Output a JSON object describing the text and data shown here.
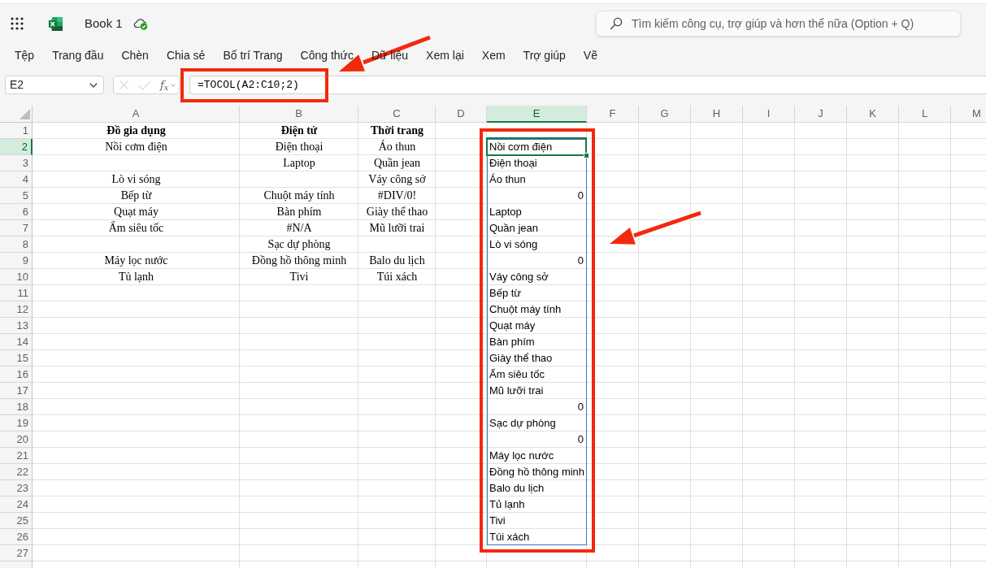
{
  "app": {
    "document_title": "Book 1"
  },
  "search": {
    "placeholder": "Tìm kiếm công cụ, trợ giúp và hơn thế nữa (Option + Q)"
  },
  "ribbon_tabs": [
    "Tệp",
    "Trang đầu",
    "Chèn",
    "Chia sẻ",
    "Bố trí Trang",
    "Công thức",
    "Dữ liệu",
    "Xem lại",
    "Xem",
    "Trợ giúp",
    "Vẽ"
  ],
  "formula_bar": {
    "name_box": "E2",
    "edit_buttons_disabled": true,
    "function_label": "f$_{x}$",
    "formula": "=TOCOL(A2:C10;2)"
  },
  "sheet": {
    "columns": [
      {
        "label": "A",
        "selected": false
      },
      {
        "label": "B",
        "selected": false
      },
      {
        "label": "C",
        "selected": false
      },
      {
        "label": "D",
        "selected": false
      },
      {
        "label": "E",
        "selected": true
      },
      {
        "label": "F",
        "selected": false
      },
      {
        "label": "G",
        "selected": false
      },
      {
        "label": "H",
        "selected": false
      },
      {
        "label": "I",
        "selected": false
      },
      {
        "label": "J",
        "selected": false
      },
      {
        "label": "K",
        "selected": false
      },
      {
        "label": "L",
        "selected": false
      },
      {
        "label": "M",
        "selected": false
      }
    ],
    "spill_outline": true,
    "rows": [
      {
        "label": "1",
        "selected": false,
        "cells": [
          {
            "kind": "text",
            "text": "Đồ gia dụng",
            "bold": true
          },
          {
            "kind": "text",
            "text": "Điện tử",
            "bold": true
          },
          {
            "kind": "text",
            "text": "Thời trang",
            "bold": true
          }
        ]
      },
      {
        "label": "2",
        "selected": true,
        "cells": [
          {
            "kind": "text",
            "text": "Nồi cơm điện",
            "bold": false
          },
          {
            "kind": "text",
            "text": "Điện thoại",
            "bold": false
          },
          {
            "kind": "text",
            "text": "Áo thun",
            "bold": false
          }
        ],
        "result": {
          "kind": "text",
          "text": "Nồi cơm điện"
        }
      },
      {
        "label": "3",
        "selected": false,
        "cells": [
          {
            "kind": "blank"
          },
          {
            "kind": "text",
            "text": "Laptop",
            "bold": false
          },
          {
            "kind": "text",
            "text": "Quần jean",
            "bold": false
          }
        ],
        "result": {
          "kind": "text",
          "text": "Điện thoại"
        }
      },
      {
        "label": "4",
        "selected": false,
        "cells": [
          {
            "kind": "text",
            "text": "Lò vi sóng",
            "bold": false
          },
          {
            "kind": "blank"
          },
          {
            "kind": "text",
            "text": "Váy công sở",
            "bold": false
          }
        ],
        "result": {
          "kind": "text",
          "text": "Áo thun"
        }
      },
      {
        "label": "5",
        "selected": false,
        "cells": [
          {
            "kind": "text",
            "text": "Bếp từ",
            "bold": false
          },
          {
            "kind": "text",
            "text": "Chuột máy tính",
            "bold": false
          },
          {
            "kind": "text",
            "text": "#DIV/0!",
            "bold": false
          }
        ],
        "result": {
          "kind": "number",
          "text": "0"
        }
      },
      {
        "label": "6",
        "selected": false,
        "cells": [
          {
            "kind": "text",
            "text": "Quạt máy",
            "bold": false
          },
          {
            "kind": "text",
            "text": "Bàn phím",
            "bold": false
          },
          {
            "kind": "text",
            "text": "Giày thể thao",
            "bold": false
          }
        ],
        "result": {
          "kind": "text",
          "text": "Laptop"
        }
      },
      {
        "label": "7",
        "selected": false,
        "cells": [
          {
            "kind": "text",
            "text": "Ấm siêu tốc",
            "bold": false
          },
          {
            "kind": "text",
            "text": "#N/A",
            "bold": false
          },
          {
            "kind": "text",
            "text": "Mũ lưỡi trai",
            "bold": false
          }
        ],
        "result": {
          "kind": "text",
          "text": "Quần jean"
        }
      },
      {
        "label": "8",
        "selected": false,
        "cells": [
          {
            "kind": "blank"
          },
          {
            "kind": "text",
            "text": "Sạc dự phòng",
            "bold": false
          },
          {
            "kind": "blank"
          }
        ],
        "result": {
          "kind": "text",
          "text": "Lò vi sóng"
        }
      },
      {
        "label": "9",
        "selected": false,
        "cells": [
          {
            "kind": "text",
            "text": "Máy lọc nước",
            "bold": false
          },
          {
            "kind": "text",
            "text": "Đồng hồ thông minh",
            "bold": false
          },
          {
            "kind": "text",
            "text": "Balo du lịch",
            "bold": false
          }
        ],
        "result": {
          "kind": "number",
          "text": "0"
        }
      },
      {
        "label": "10",
        "selected": false,
        "cells": [
          {
            "kind": "text",
            "text": "Tủ lạnh",
            "bold": false
          },
          {
            "kind": "text",
            "text": "Tivi",
            "bold": false
          },
          {
            "kind": "text",
            "text": "Túi xách",
            "bold": false
          }
        ],
        "result": {
          "kind": "text",
          "text": "Váy công sở"
        }
      },
      {
        "label": "11",
        "selected": false,
        "result": {
          "kind": "text",
          "text": "Bếp từ"
        }
      },
      {
        "label": "12",
        "selected": false,
        "result": {
          "kind": "text",
          "text": "Chuột máy tính"
        }
      },
      {
        "label": "13",
        "selected": false,
        "result": {
          "kind": "text",
          "text": "Quạt máy"
        }
      },
      {
        "label": "14",
        "selected": false,
        "result": {
          "kind": "text",
          "text": "Bàn phím"
        }
      },
      {
        "label": "15",
        "selected": false,
        "result": {
          "kind": "text",
          "text": "Giày thể thao"
        }
      },
      {
        "label": "16",
        "selected": false,
        "result": {
          "kind": "text",
          "text": "Ấm siêu tốc"
        }
      },
      {
        "label": "17",
        "selected": false,
        "result": {
          "kind": "text",
          "text": "Mũ lưỡi trai"
        }
      },
      {
        "label": "18",
        "selected": false,
        "result": {
          "kind": "number",
          "text": "0"
        }
      },
      {
        "label": "19",
        "selected": false,
        "result": {
          "kind": "text",
          "text": "Sạc dự phòng"
        }
      },
      {
        "label": "20",
        "selected": false,
        "result": {
          "kind": "number",
          "text": "0"
        }
      },
      {
        "label": "21",
        "selected": false,
        "result": {
          "kind": "text",
          "text": "Máy lọc nước"
        }
      },
      {
        "label": "22",
        "selected": false,
        "result": {
          "kind": "text",
          "text": "Đồng hồ thông minh"
        }
      },
      {
        "label": "23",
        "selected": false,
        "result": {
          "kind": "text",
          "text": "Balo du lịch"
        }
      },
      {
        "label": "24",
        "selected": false,
        "result": {
          "kind": "text",
          "text": "Tủ lạnh"
        }
      },
      {
        "label": "25",
        "selected": false,
        "result": {
          "kind": "text",
          "text": "Tivi"
        }
      },
      {
        "label": "26",
        "selected": false,
        "result": {
          "kind": "text",
          "text": "Túi xách"
        }
      },
      {
        "label": "27",
        "selected": false
      }
    ]
  }
}
